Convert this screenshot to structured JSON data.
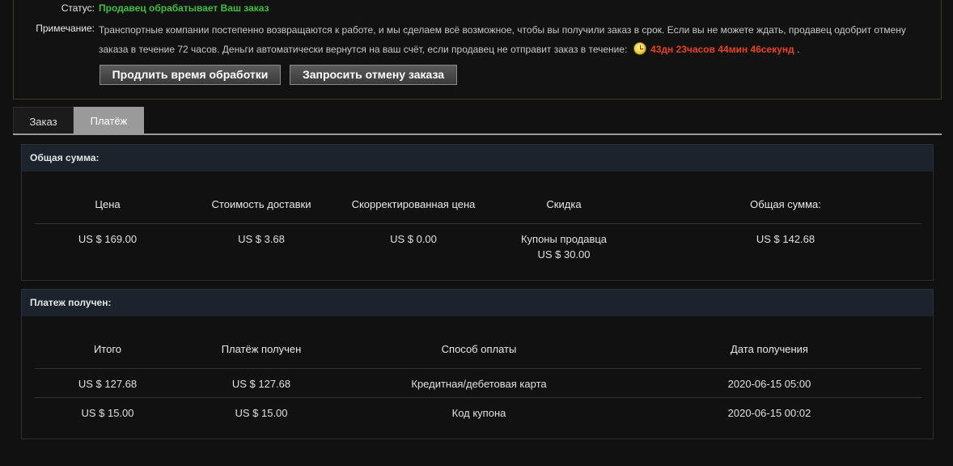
{
  "status": {
    "label": "Статус:",
    "value": "Продавец обрабатывает Ваш заказ",
    "note_label": "Примечание:",
    "note_text": "Транспортные компании постепенно возвращаются к работе, и мы сделаем всё возможное, чтобы вы получили заказ в срок. Если вы не можете ждать, продавец одобрит отмену заказа в течение 72 часов. Деньги автоматически вернутся на ваш счёт, если продавец не отправит заказ в течение:",
    "countdown": "43дн 23часов 44мин 46секунд",
    "countdown_suffix": ".",
    "icon": "clock-icon",
    "colors": {
      "status": "#3fbf3f",
      "countdown": "#e8431f"
    }
  },
  "buttons": {
    "extend_label": "Продлить время обработки",
    "cancel_label": "Запросить отмену заказа"
  },
  "tabs": [
    {
      "label": "Заказ",
      "active": false
    },
    {
      "label": "Платёж",
      "active": true
    }
  ],
  "total_panel": {
    "title": "Общая сумма:",
    "headers": [
      "Цена",
      "Стоимость доставки",
      "Скорректированная цена",
      "Скидка",
      "Общая сумма:"
    ],
    "values": {
      "price": "US $ 169.00",
      "shipping": "US $ 3.68",
      "adjusted": "US $ 0.00",
      "discount_line1": "Купоны продавца",
      "discount_line2": "US $ 30.00",
      "total": "US $ 142.68"
    }
  },
  "paid_panel": {
    "title": "Платеж получен:",
    "headers": [
      "Итого",
      "Платёж получен",
      "Способ оплаты",
      "Дата получения"
    ],
    "rows": [
      {
        "total": "US $ 127.68",
        "received": "US $ 127.68",
        "method": "Кредитная/дебетовая карта",
        "date": "2020-06-15 05:00"
      },
      {
        "total": "US $ 15.00",
        "received": "US $ 15.00",
        "method": "Код купона",
        "date": "2020-06-15 00:02"
      }
    ]
  }
}
